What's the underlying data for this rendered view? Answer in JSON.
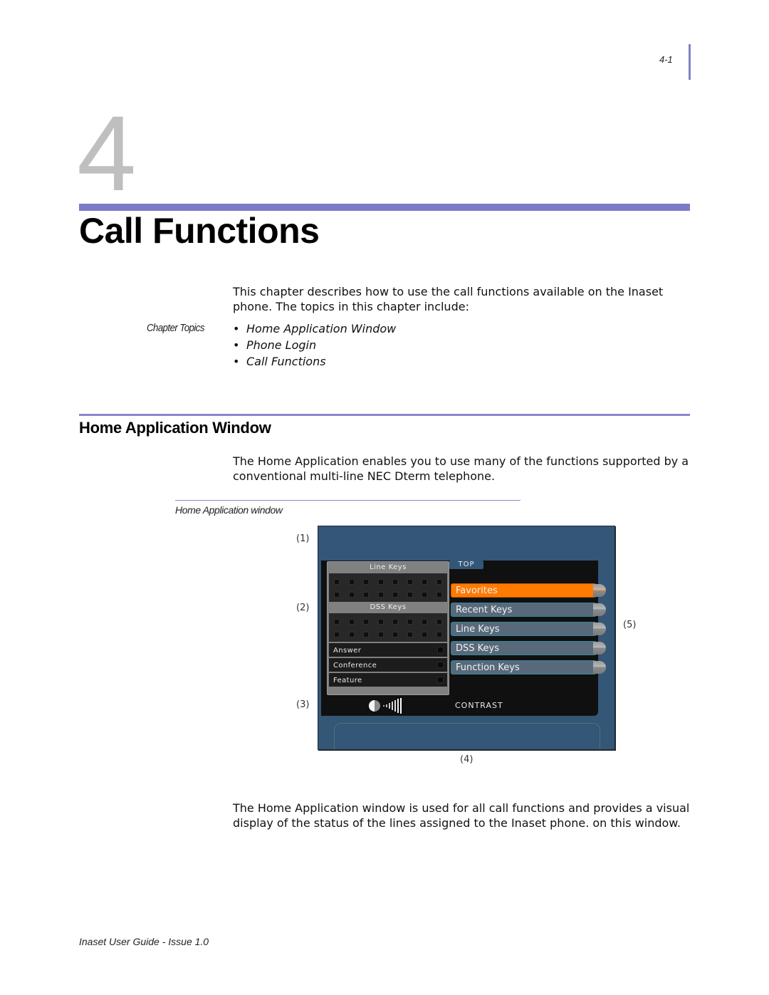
{
  "page": {
    "number": "4-1",
    "chapter_number": "4",
    "chapter_title": "Call Functions",
    "footer": "Inaset User Guide - Issue 1.0"
  },
  "intro": {
    "text": "This chapter describes how to use the call functions available on the Inaset phone. The topics in this chapter include:",
    "topics_label": "Chapter Topics",
    "topics": [
      "Home Application Window",
      "Phone Login",
      "Call Functions"
    ]
  },
  "section": {
    "title": "Home Application Window",
    "para1": "The Home Application enables you to use many of the functions supported by a conventional multi-line NEC Dterm telephone.",
    "figure_caption": "Home Application window",
    "para2": "The Home Application window is used for all call functions and provides a visual display of the status of the lines assigned to the Inaset phone. on this window."
  },
  "figure": {
    "callouts": [
      "(1)",
      "(2)",
      "(3)",
      "(4)",
      "(5)"
    ],
    "screen": {
      "line_keys_header": "Line Keys",
      "dss_keys_header": "DSS Keys",
      "line_key_count": 16,
      "dss_key_count": 16,
      "function_rows": [
        "Answer",
        "Conference",
        "Feature"
      ],
      "top_tab": "TOP",
      "menu": [
        {
          "label": "Favorites",
          "active": true
        },
        {
          "label": "Recent Keys",
          "active": false
        },
        {
          "label": "Line Keys",
          "active": false
        },
        {
          "label": "DSS Keys",
          "active": false
        },
        {
          "label": "Function Keys",
          "active": false
        }
      ],
      "contrast_label": "CONTRAST",
      "colors": {
        "frame": "#345677",
        "screen_bg": "#101010",
        "active_item": "#ff7a00",
        "menu_item": "#58697b"
      }
    }
  }
}
